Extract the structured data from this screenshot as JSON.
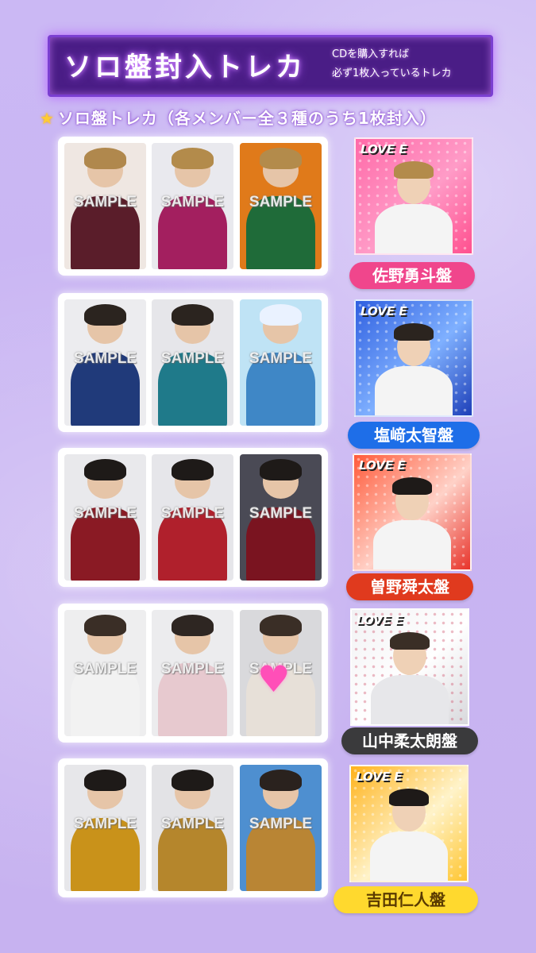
{
  "header": {
    "title": "ソロ盤封入トレカ",
    "note_line1": "CDを購入すれば",
    "note_line2": "必ず1枚入っているトレカ"
  },
  "subtitle": "ソロ盤トレカ（各メンバー全３種のうち1枚封入）",
  "star_icon": "star-icon",
  "watermark": "SAMPLE",
  "album_logo": "LOVE E"
}
